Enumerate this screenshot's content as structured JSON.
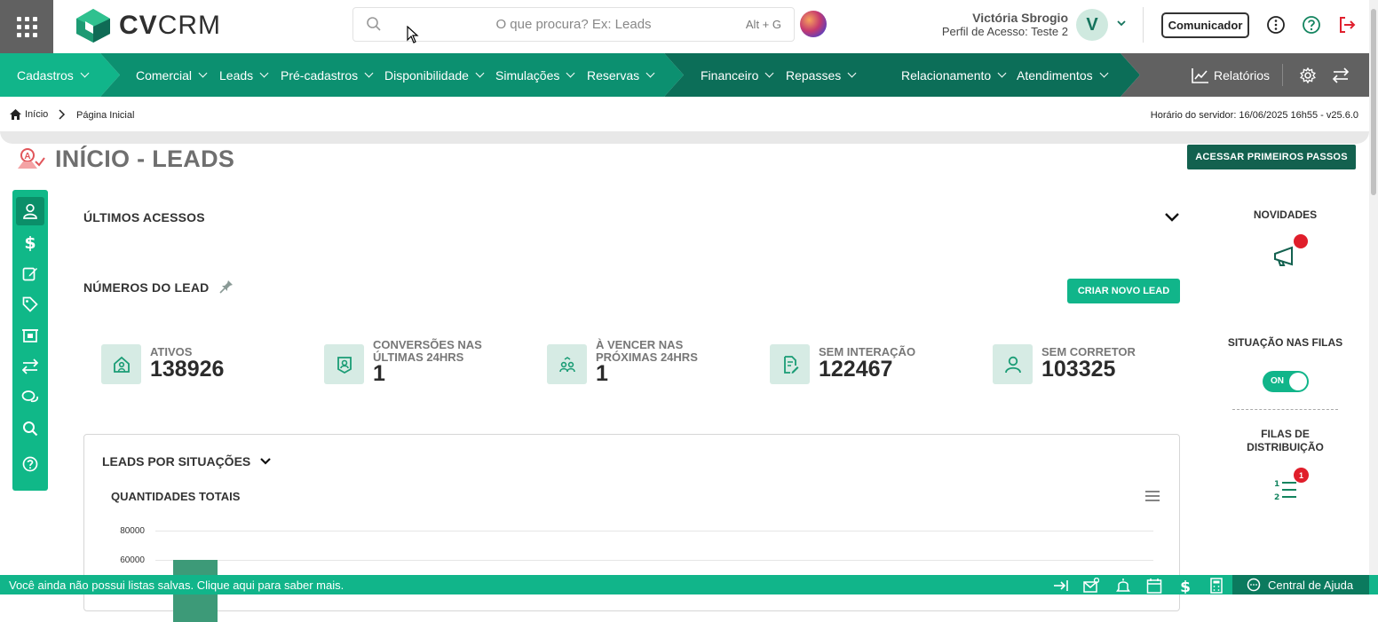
{
  "app": {
    "logo_text_bold": "CV",
    "logo_text_light": "CRM",
    "search_placeholder": "O que procura? Ex: Leads",
    "search_shortcut": "Alt + G"
  },
  "user": {
    "name": "Victória Sbrogio",
    "profile": "Perfil de Acesso: Teste 2",
    "avatar_letter": "V"
  },
  "header": {
    "comunicador_label": "Comunicador"
  },
  "nav": {
    "items": [
      {
        "label": "Cadastros"
      },
      {
        "label": "Comercial"
      },
      {
        "label": "Leads"
      },
      {
        "label": "Pré-cadastros"
      },
      {
        "label": "Disponibilidade"
      },
      {
        "label": "Simulações"
      },
      {
        "label": "Reservas"
      },
      {
        "label": "Financeiro"
      },
      {
        "label": "Repasses"
      },
      {
        "label": "Relacionamento"
      },
      {
        "label": "Atendimentos"
      }
    ],
    "reports_label": "Relatórios",
    "colors": {
      "primary": "#11b58a",
      "mid": "#0c9070",
      "dark": "#0c6e58",
      "grey": "#616161"
    }
  },
  "breadcrumb": {
    "home": "Início",
    "current": "Página Inicial",
    "server_time": "Horário do servidor: 16/06/2025 16h55 - v25.6.0"
  },
  "page": {
    "title": "INÍCIO - LEADS",
    "first_steps_button": "ACESSAR PRIMEIROS PASSOS"
  },
  "sections": {
    "recent_access": "ÚLTIMOS ACESSOS",
    "lead_numbers": "NÚMEROS DO LEAD",
    "create_lead_button": "CRIAR NOVO LEAD"
  },
  "metrics": [
    {
      "label": "ATIVOS",
      "value": "138926",
      "icon": "house-user-icon"
    },
    {
      "label": "CONVERSÕES NAS ÚLTIMAS 24HRS",
      "value": "1",
      "icon": "badge-user-icon"
    },
    {
      "label": "À VENCER NAS PRÓXIMAS 24HRS",
      "value": "1",
      "icon": "users-exchange-icon"
    },
    {
      "label": "SEM INTERAÇÃO",
      "value": "122467",
      "icon": "document-edit-icon"
    },
    {
      "label": "SEM CORRETOR",
      "value": "103325",
      "icon": "user-icon"
    }
  ],
  "chart_card": {
    "title": "LEADS POR SITUAÇÕES",
    "subtitle": "QUANTIDADES TOTAIS"
  },
  "chart_data": {
    "type": "bar",
    "title": "QUANTIDADES TOTAIS",
    "y_ticks": [
      "80000",
      "60000"
    ],
    "ylim_visible": [
      60000,
      80000
    ],
    "visible_bar": {
      "value_min": 60000
    }
  },
  "right_panel": {
    "news_title": "NOVIDADES",
    "queue_status_title": "SITUAÇÃO NAS FILAS",
    "toggle_label": "ON",
    "toggle_on": true,
    "distribution_title": "FILAS DE DISTRIBUIÇÃO",
    "distribution_badge": "1"
  },
  "footer": {
    "message": "Você ainda não possui listas salvas. Clique aqui para saber mais.",
    "help_label": "Central de Ajuda"
  }
}
